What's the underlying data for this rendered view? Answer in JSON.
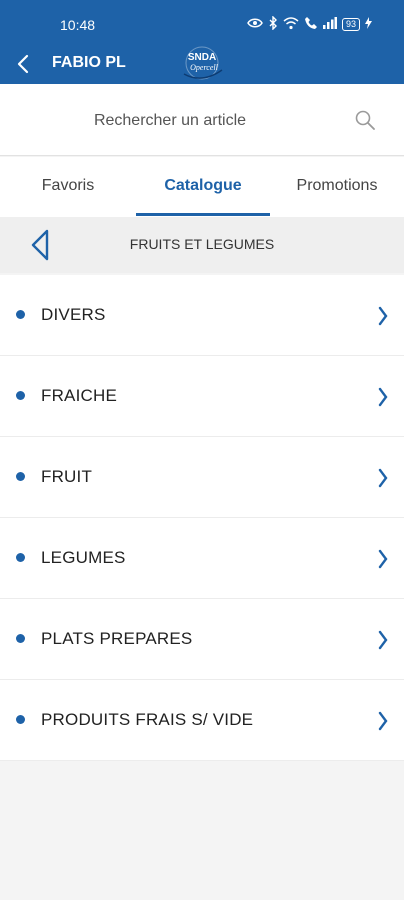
{
  "status": {
    "time": "10:48",
    "battery": "93"
  },
  "appbar": {
    "title": "FABIO PL",
    "logo_line1": "SNDA",
    "logo_line2": "Opercell"
  },
  "search": {
    "placeholder": "Rechercher un article"
  },
  "tabs": [
    {
      "label": "Favoris"
    },
    {
      "label": "Catalogue"
    },
    {
      "label": "Promotions"
    }
  ],
  "active_tab": "Catalogue",
  "category": {
    "title": "FRUITS ET LEGUMES"
  },
  "items": [
    {
      "label": "DIVERS"
    },
    {
      "label": "FRAICHE"
    },
    {
      "label": "FRUIT"
    },
    {
      "label": "LEGUMES"
    },
    {
      "label": "PLATS PREPARES"
    },
    {
      "label": "PRODUITS FRAIS S/ VIDE"
    }
  ],
  "colors": {
    "primary": "#1e62a8",
    "background": "#f4f4f4",
    "surface": "#ffffff"
  }
}
